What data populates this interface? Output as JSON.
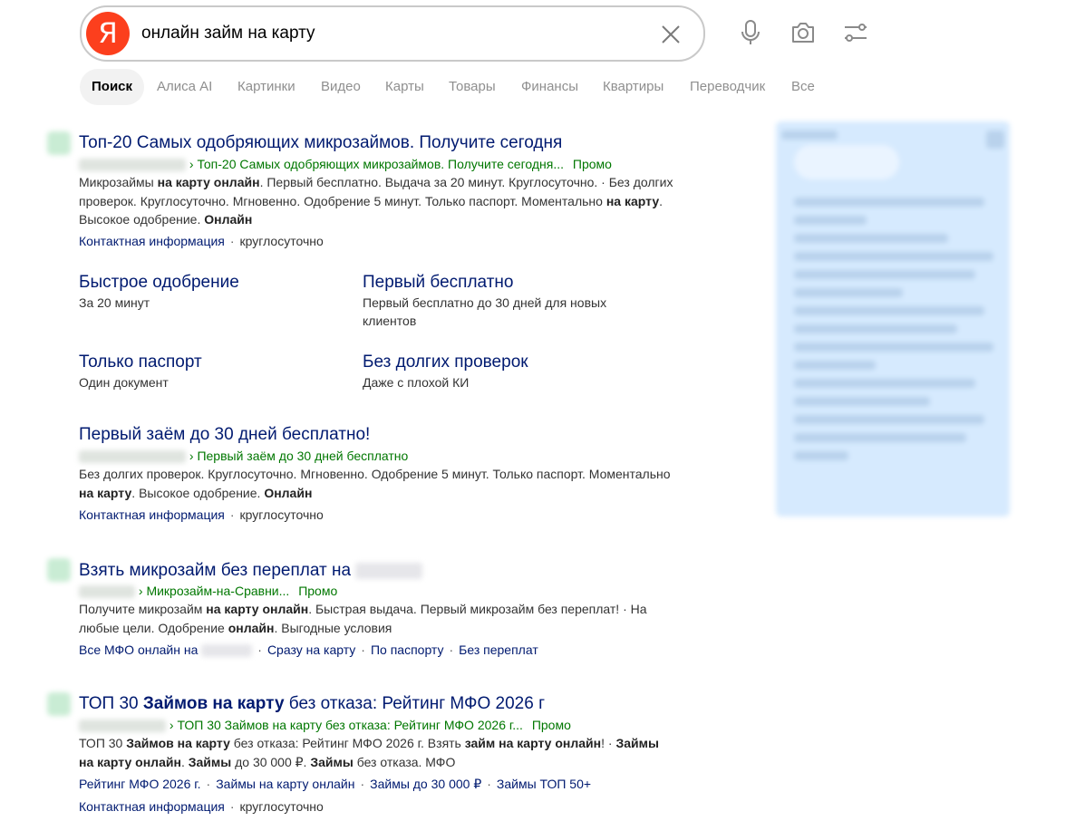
{
  "search": {
    "logo": "Я",
    "query": "онлайн займ на карту",
    "icons": [
      "close-icon",
      "microphone-icon",
      "camera-icon",
      "filters-icon"
    ]
  },
  "tabs": [
    {
      "label": "Поиск",
      "active": true
    },
    {
      "label": "Алиса AI"
    },
    {
      "label": "Картинки"
    },
    {
      "label": "Видео"
    },
    {
      "label": "Карты"
    },
    {
      "label": "Товары"
    },
    {
      "label": "Финансы"
    },
    {
      "label": "Квартиры"
    },
    {
      "label": "Переводчик"
    },
    {
      "label": "Все"
    }
  ],
  "results": [
    {
      "title": "Топ-20 Самых одобряющих микрозаймов. Получите сегодня",
      "url_path": "› Топ-20 Самых одобряющих микрозаймов. Получите сегодня...",
      "promo": "Промо",
      "text": [
        "Микрозаймы ",
        "на карту онлайн",
        ". Первый бесплатно. Выдача за 20 минут. Круглосуточно. · Без долгих проверок. Круглосуточно. Мгновенно. Одобрение 5 минут. Только паспорт. Мо­ментально ",
        "на карту",
        ". Высокое одобрение. ",
        "Онлайн"
      ],
      "contact": "Контактная информация",
      "hours": "круглосуточно",
      "sitelinks": [
        {
          "title": "Быстрое одобрение",
          "desc": "За 20 минут"
        },
        {
          "title": "Первый бесплатно",
          "desc": "Первый бесплатно до 30 дней для новых клиентов"
        },
        {
          "title": "Только паспорт",
          "desc": "Один документ"
        },
        {
          "title": "Без долгих проверок",
          "desc": "Даже с плохой КИ"
        }
      ]
    },
    {
      "title": "Первый заём до 30 дней бесплатно!",
      "url_path": "› Первый заём до 30 дней бесплатно",
      "text": [
        "Без долгих проверок. Круглосуточно. Мгновенно. Одобрение 5 минут. Только паспорт. Мо­ментально ",
        "на карту",
        ". Высокое одобрение. ",
        "Онлайн"
      ],
      "contact": "Контактная информация",
      "hours": "круглосуточно"
    },
    {
      "title": "Взять микрозайм без переплат на",
      "url_path": "› Микрозайм-на-Сравни...",
      "promo": "Промо",
      "text": [
        "Получите микрозайм ",
        "на карту онлайн",
        ". Быстрая выдача. Первый микрозайм без пере­плат! · На любые цели. Одобрение ",
        "онлайн",
        ". Выгодные условия"
      ],
      "links": [
        "Все МФО онлайн на",
        "Сразу на карту",
        "По паспорту",
        "Без переплат"
      ]
    },
    {
      "title_parts": [
        "ТОП 30 ",
        "Займов на карту",
        " без отказа: Рейтинг МФО 2026 г"
      ],
      "url_path": "› ТОП 30 Займов на карту без отказа: Рейтинг МФО 2026 г...",
      "promo": "Промо",
      "text": [
        "ТОП 30 ",
        "Займов на карту",
        " без отказа: Рейтинг МФО 2026 г. Взять ",
        "займ на карту онлайн",
        "! · ",
        "Займы на карту онлайн",
        ". ",
        "Займы",
        " до 30 000 ₽. ",
        "Займы",
        " без отказа. МФО"
      ],
      "links": [
        "Рейтинг МФО 2026 г.",
        "Займы на карту онлайн",
        "Займы до 30 000 ₽",
        "Займы ТОП 50+"
      ],
      "contact": "Контактная информация",
      "hours": "круглосуточно"
    }
  ],
  "colors": {
    "title": "#001a70",
    "url": "#007700",
    "logo": "#fc3f1d",
    "side_panel": "#d6eafe"
  }
}
